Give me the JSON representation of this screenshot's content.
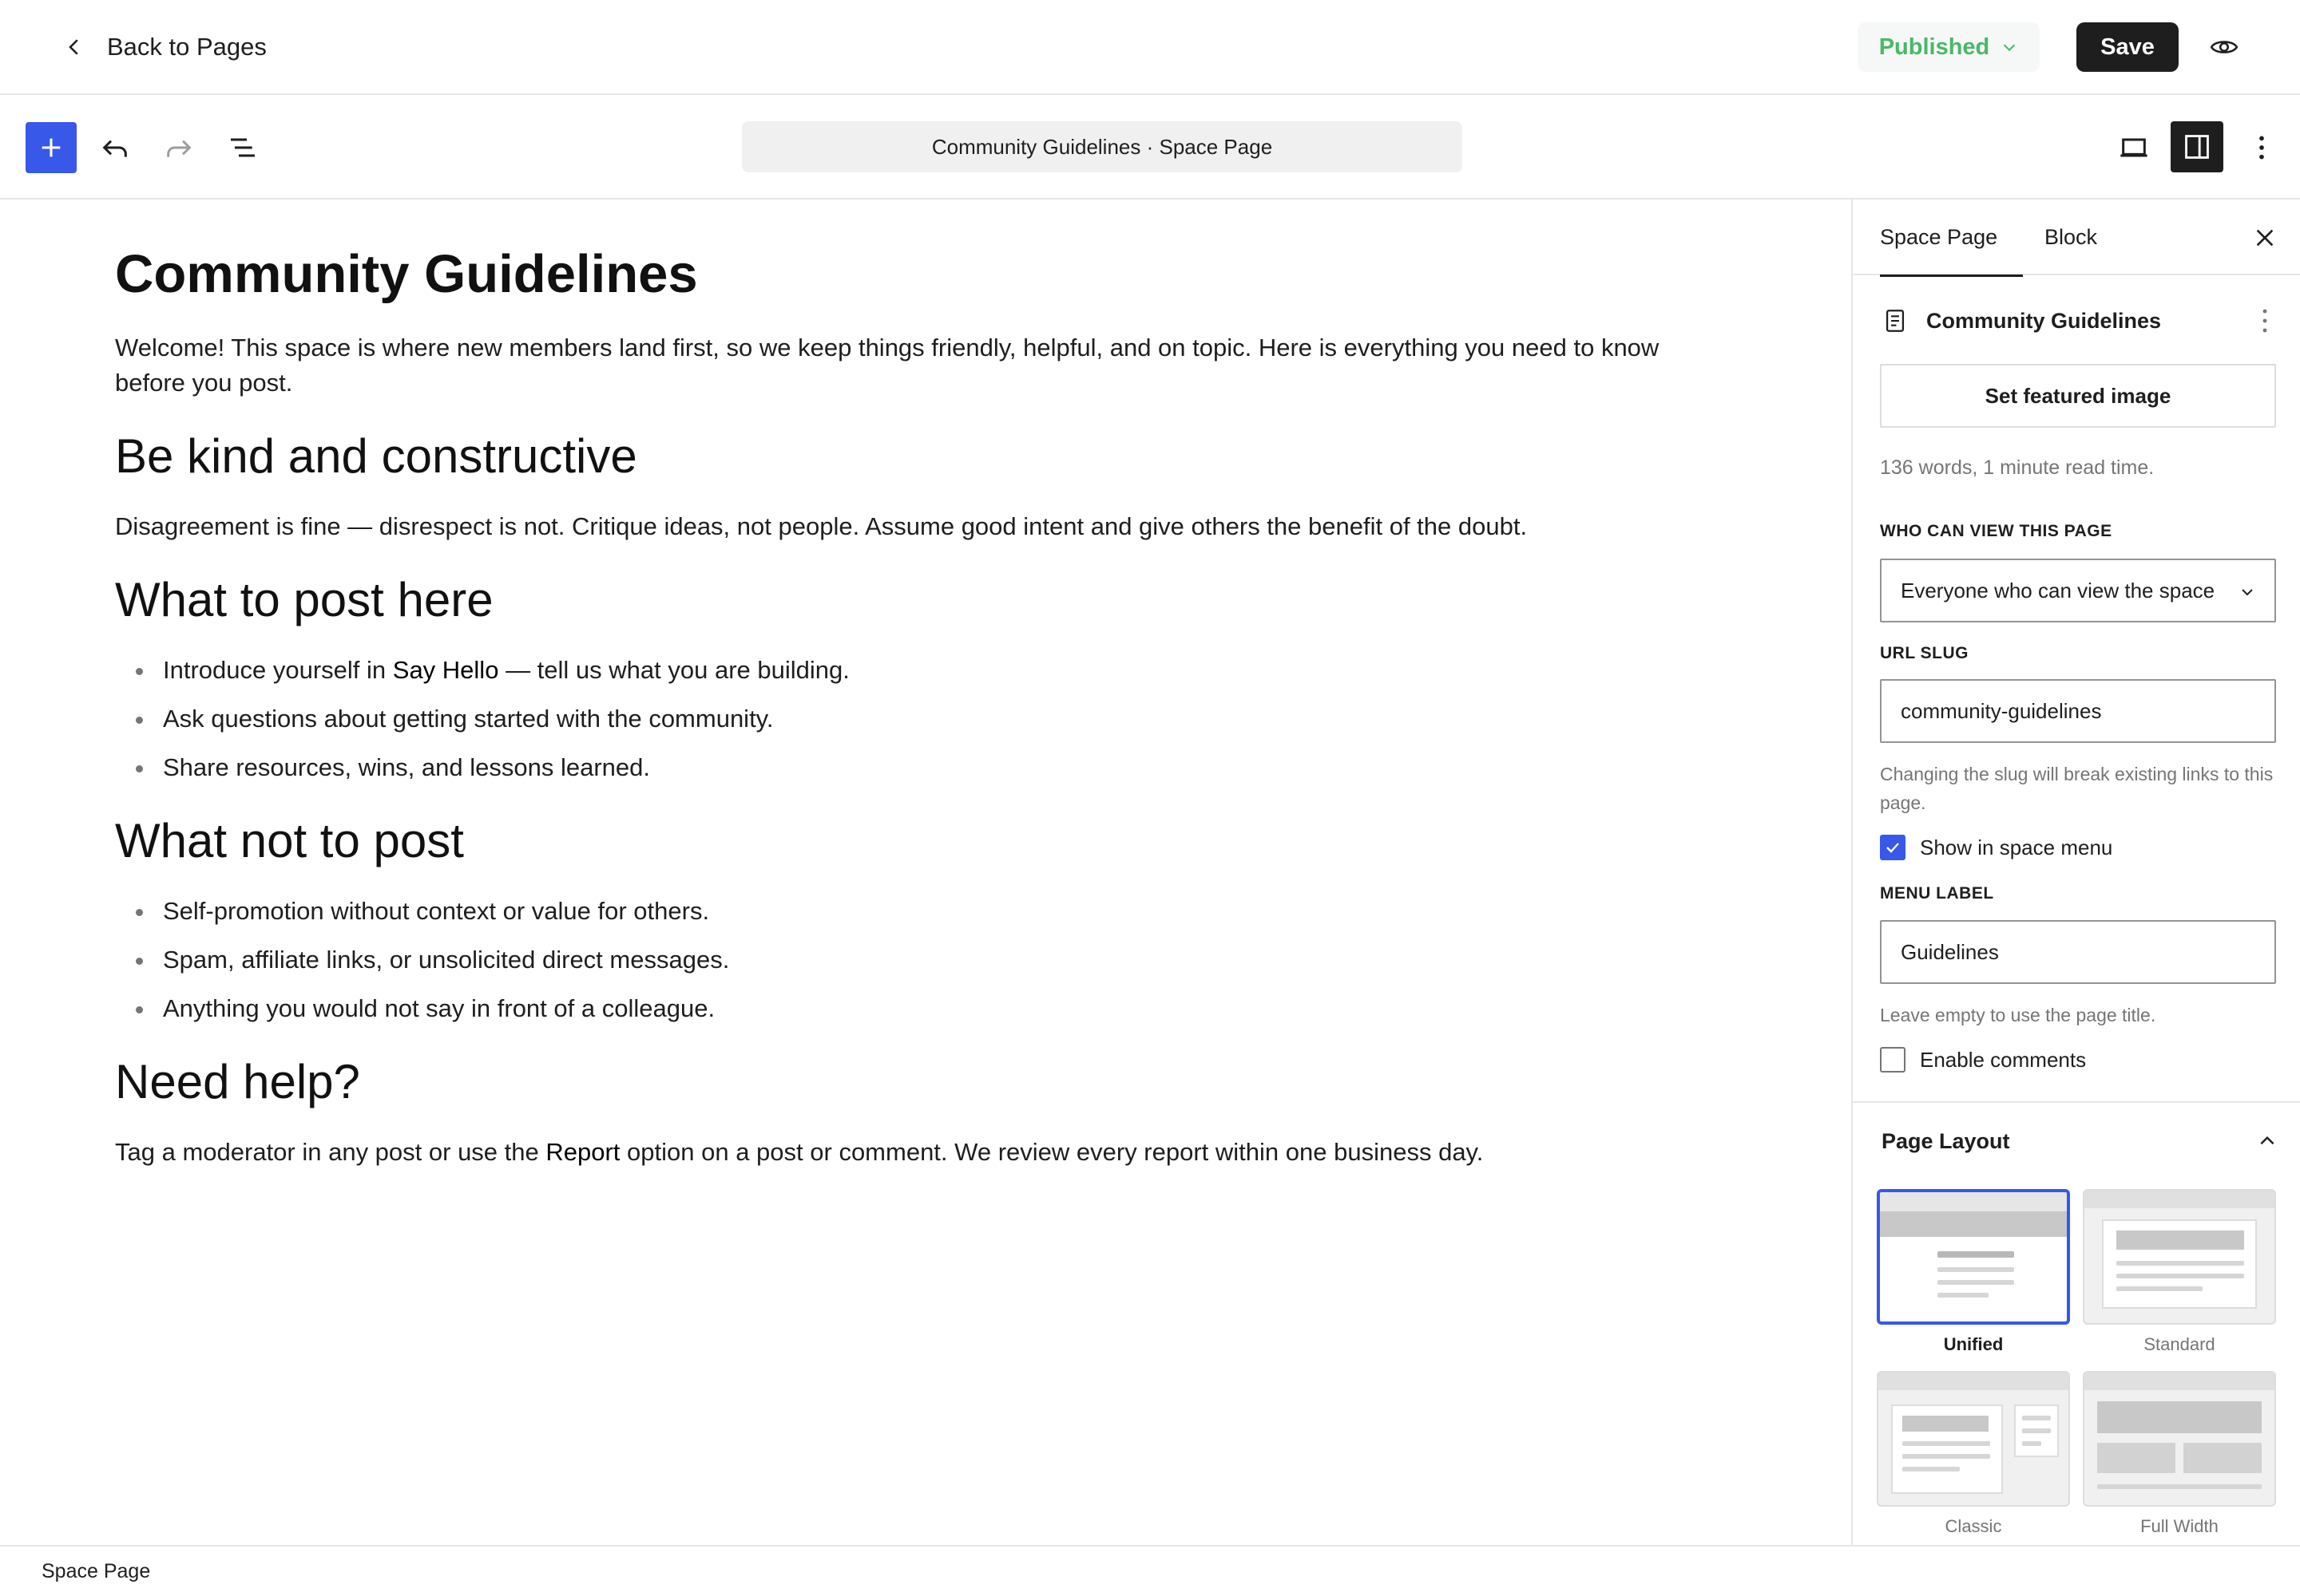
{
  "header": {
    "back_label": "Back to Pages",
    "status_label": "Published",
    "save_label": "Save"
  },
  "toolbar": {
    "document_title": "Community Guidelines · Space Page"
  },
  "content": {
    "title": "Community Guidelines",
    "intro": "Welcome! This space is where new members land first, so we keep things friendly, helpful, and on topic. Here is everything you need to know before you post.",
    "section1": {
      "heading": "Be kind and constructive",
      "text": "Disagreement is fine — disrespect is not. Critique ideas, not people. Assume good intent and give others the benefit of the doubt."
    },
    "section2": {
      "heading": "What to post here",
      "items": [
        {
          "before": "Introduce yourself in ",
          "strong": "Say Hello",
          "after": " — tell us what you are building."
        },
        {
          "text": "Ask questions about getting started with the community."
        },
        {
          "text": "Share resources, wins, and lessons learned."
        }
      ]
    },
    "section3": {
      "heading": "What not to post",
      "items": [
        "Self-promotion without context or value for others.",
        "Spam, affiliate links, or unsolicited direct messages.",
        "Anything you would not say in front of a colleague."
      ]
    },
    "section4": {
      "heading": "Need help?",
      "before": "Tag a moderator in any post or use the ",
      "strong": "Report",
      "after": " option on a post or comment. We review every report within one business day."
    }
  },
  "sidebar": {
    "tabs": [
      "Space Page",
      "Block"
    ],
    "panel_title": "Community Guidelines",
    "featured_image_label": "Set featured image",
    "word_count": "136 words, 1 minute read time.",
    "visibility": {
      "label": "Who can view this page",
      "value": "Everyone who can view the space"
    },
    "slug": {
      "label": "URL Slug",
      "value": "community-guidelines",
      "hint": "Changing the slug will break existing links to this page."
    },
    "show_in_menu": {
      "label": "Show in space menu",
      "checked": true
    },
    "menu_label": {
      "label": "Menu Label",
      "value": "Guidelines",
      "hint": "Leave empty to use the page title."
    },
    "enable_comments": {
      "label": "Enable comments",
      "checked": false
    },
    "page_layout": {
      "title": "Page Layout",
      "options": [
        "Unified",
        "Standard",
        "Classic",
        "Full Width"
      ],
      "selected": "Unified"
    }
  },
  "footer": {
    "breadcrumb": "Space Page"
  },
  "colors": {
    "accent": "#3858e9",
    "published": "#4ab866",
    "dark": "#1e1e1e"
  }
}
